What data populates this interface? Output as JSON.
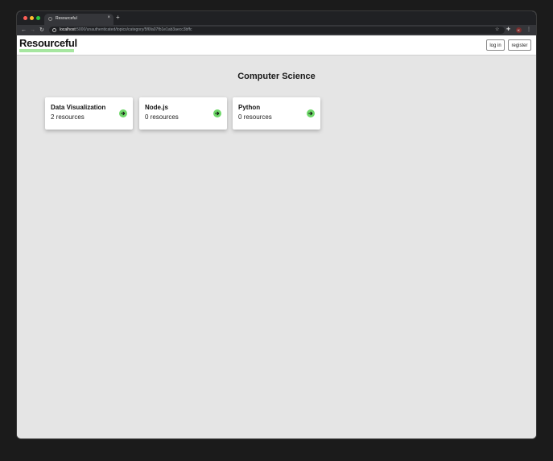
{
  "browser": {
    "tab_title": "Resourceful",
    "tab_close": "×",
    "new_tab": "+",
    "url_host": "localhost",
    "url_path": ":5000/unauthenticated/topics/category/5f6fa07fb1e1ab3aecc3bffc",
    "avatar_letter": "K"
  },
  "navbar": {
    "logo": "Resourceful",
    "login_label": "log in",
    "register_label": "register",
    "accent_color": "#a6e6a0"
  },
  "main": {
    "title": "Computer Science",
    "topics": [
      {
        "name": "Data Visualization",
        "count": "2 resources"
      },
      {
        "name": "Node.js",
        "count": "0 resources"
      },
      {
        "name": "Python",
        "count": "0 resources"
      }
    ]
  }
}
